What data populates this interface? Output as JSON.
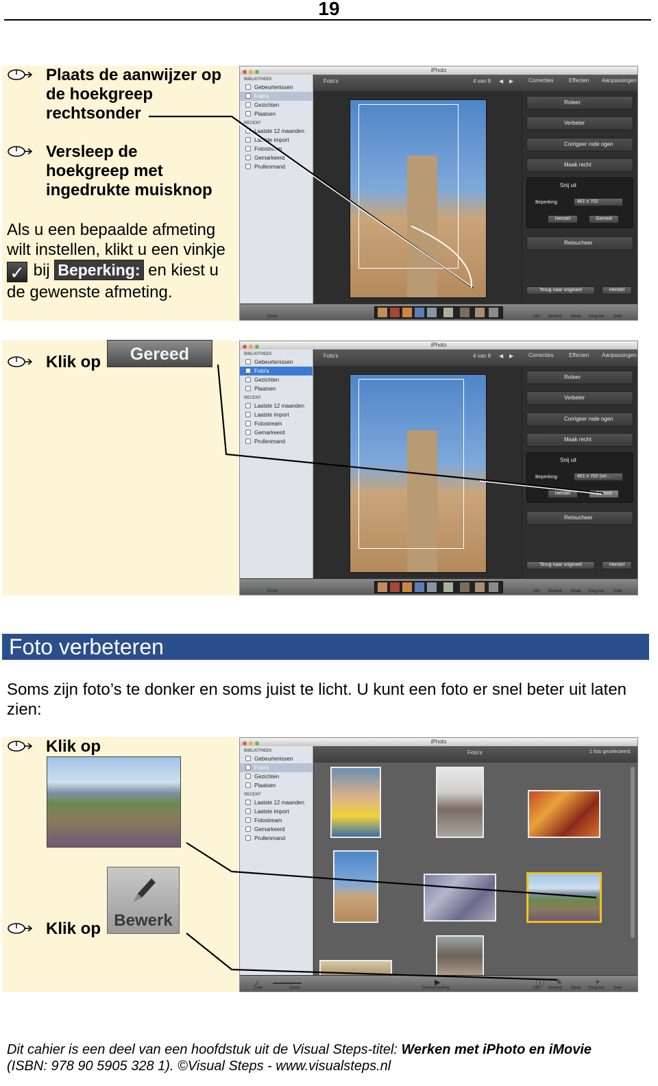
{
  "page": {
    "number": "19"
  },
  "block1": {
    "step1": "Plaats de aanwijzer op de hoekgreep rechtsonder",
    "step1_lines": [
      "Plaats de aanwijzer op",
      "de hoekgreep",
      "rechtsonder"
    ],
    "step2_lines": [
      "Versleep de",
      "hoekgreep met",
      "ingedrukte muisknop"
    ],
    "tip_line1": "Als u een bepaalde afmeting",
    "tip_line2": "wilt instellen, klikt u een vinkje",
    "tip_bij": "bij",
    "tip_badge": "Beperking:",
    "tip_check": "✓",
    "tip_line3_end": "en kiest u",
    "tip_line4": "de gewenste afmeting."
  },
  "block2": {
    "instruction": "Klik op",
    "button_image_label": "Gereed"
  },
  "section": {
    "title": "Foto verbeteren",
    "intro_line1": "Soms zijn foto’s te donker en soms juist te licht. U kunt een foto er snel beter uit laten",
    "intro_line2": "zien:"
  },
  "block3": {
    "instruction1": "Klik op",
    "instruction2": "Klik op",
    "button_image_label": "Bewerk"
  },
  "iphoto": {
    "app_title": "iPhoto",
    "library_header": "BIBLIOTHEEK",
    "recent_header": "RECENT",
    "library_items": [
      "Gebeurtenissen",
      "Foto's",
      "Gezichten",
      "Plaatsen"
    ],
    "recent_items": [
      "Laatste 12 maanden",
      "Laatste import",
      "Fotostream",
      "Gemarkeerd",
      "Prullenmand"
    ],
    "viewer_label": "Foto's",
    "counter": "4 van 8",
    "tabs": [
      "Correcties",
      "Effecten",
      "Aanpassingen"
    ],
    "tools": [
      "Roteer",
      "Verbeter",
      "Corrigeer rode ogen",
      "Maak recht",
      "Snij uit",
      "Retoucheer"
    ],
    "constraint_label": "Beperking:",
    "constraint_value_1": "461 x 702",
    "constraint_value_2": "461 x 702 (ori...",
    "reset_btn": "Herstel",
    "done_btn": "Gereed",
    "revert_btn": "Terug naar origineel",
    "restore_btn": "Herstel",
    "bottom_labels": [
      "Zoom",
      "Info",
      "Bewerk",
      "Maak",
      "Voeg toe",
      "Deel"
    ],
    "grid_title": "Foto's",
    "grid_status": "1 foto geselecteerd",
    "grid_bottom_labels": [
      "Zoek",
      "Zoom",
      "Diavoorstelling",
      "Info",
      "Bewerk",
      "Maak",
      "Voeg toe",
      "Deel"
    ]
  },
  "footer": {
    "line1_prefix": "Dit cahier is een deel van een hoofdstuk uit de Visual Steps-titel: ",
    "line1_title": "Werken met iPhoto en iMovie",
    "line2": "(ISBN: 978 90 5905 328 1). ©Visual Steps - www.visualsteps.nl"
  },
  "colors": {
    "panel_bg": "#fdf5d6",
    "section_band": "#2b4f8c",
    "selection_yellow": "#f0c419",
    "sidebar_selected": "#3b7bd4"
  }
}
